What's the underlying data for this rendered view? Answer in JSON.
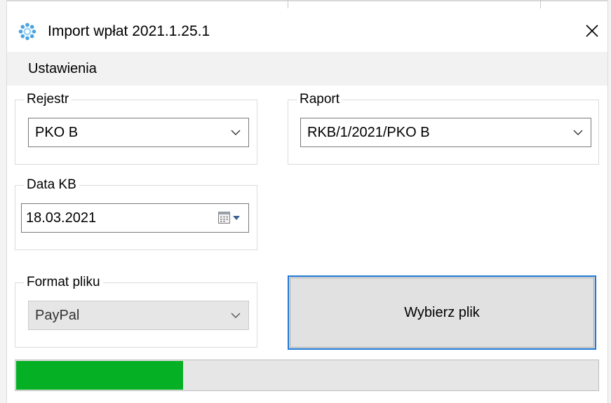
{
  "window": {
    "title": "Import wpłat 2021.1.25.1"
  },
  "menu": {
    "items": [
      {
        "label": "Ustawienia"
      }
    ]
  },
  "groups": {
    "rejestr": {
      "legend": "Rejestr",
      "selected": "PKO B"
    },
    "raport": {
      "legend": "Raport",
      "selected": "RKB/1/2021/PKO B"
    },
    "data_kb": {
      "legend": "Data KB",
      "value": "18.03.2021"
    },
    "format_pliku": {
      "legend": "Format pliku",
      "selected": "PayPal"
    }
  },
  "actions": {
    "choose_file_label": "Wybierz plik"
  },
  "progress": {
    "fraction": 0.287,
    "color": "#06b025"
  },
  "icons": {
    "app": "gear-snowflake-icon",
    "close": "close-icon",
    "dropdown": "chevron-down-icon",
    "calendar": "calendar-icon"
  },
  "colors": {
    "accent": "#1e78d7",
    "menubar": "#f2f2f2"
  }
}
